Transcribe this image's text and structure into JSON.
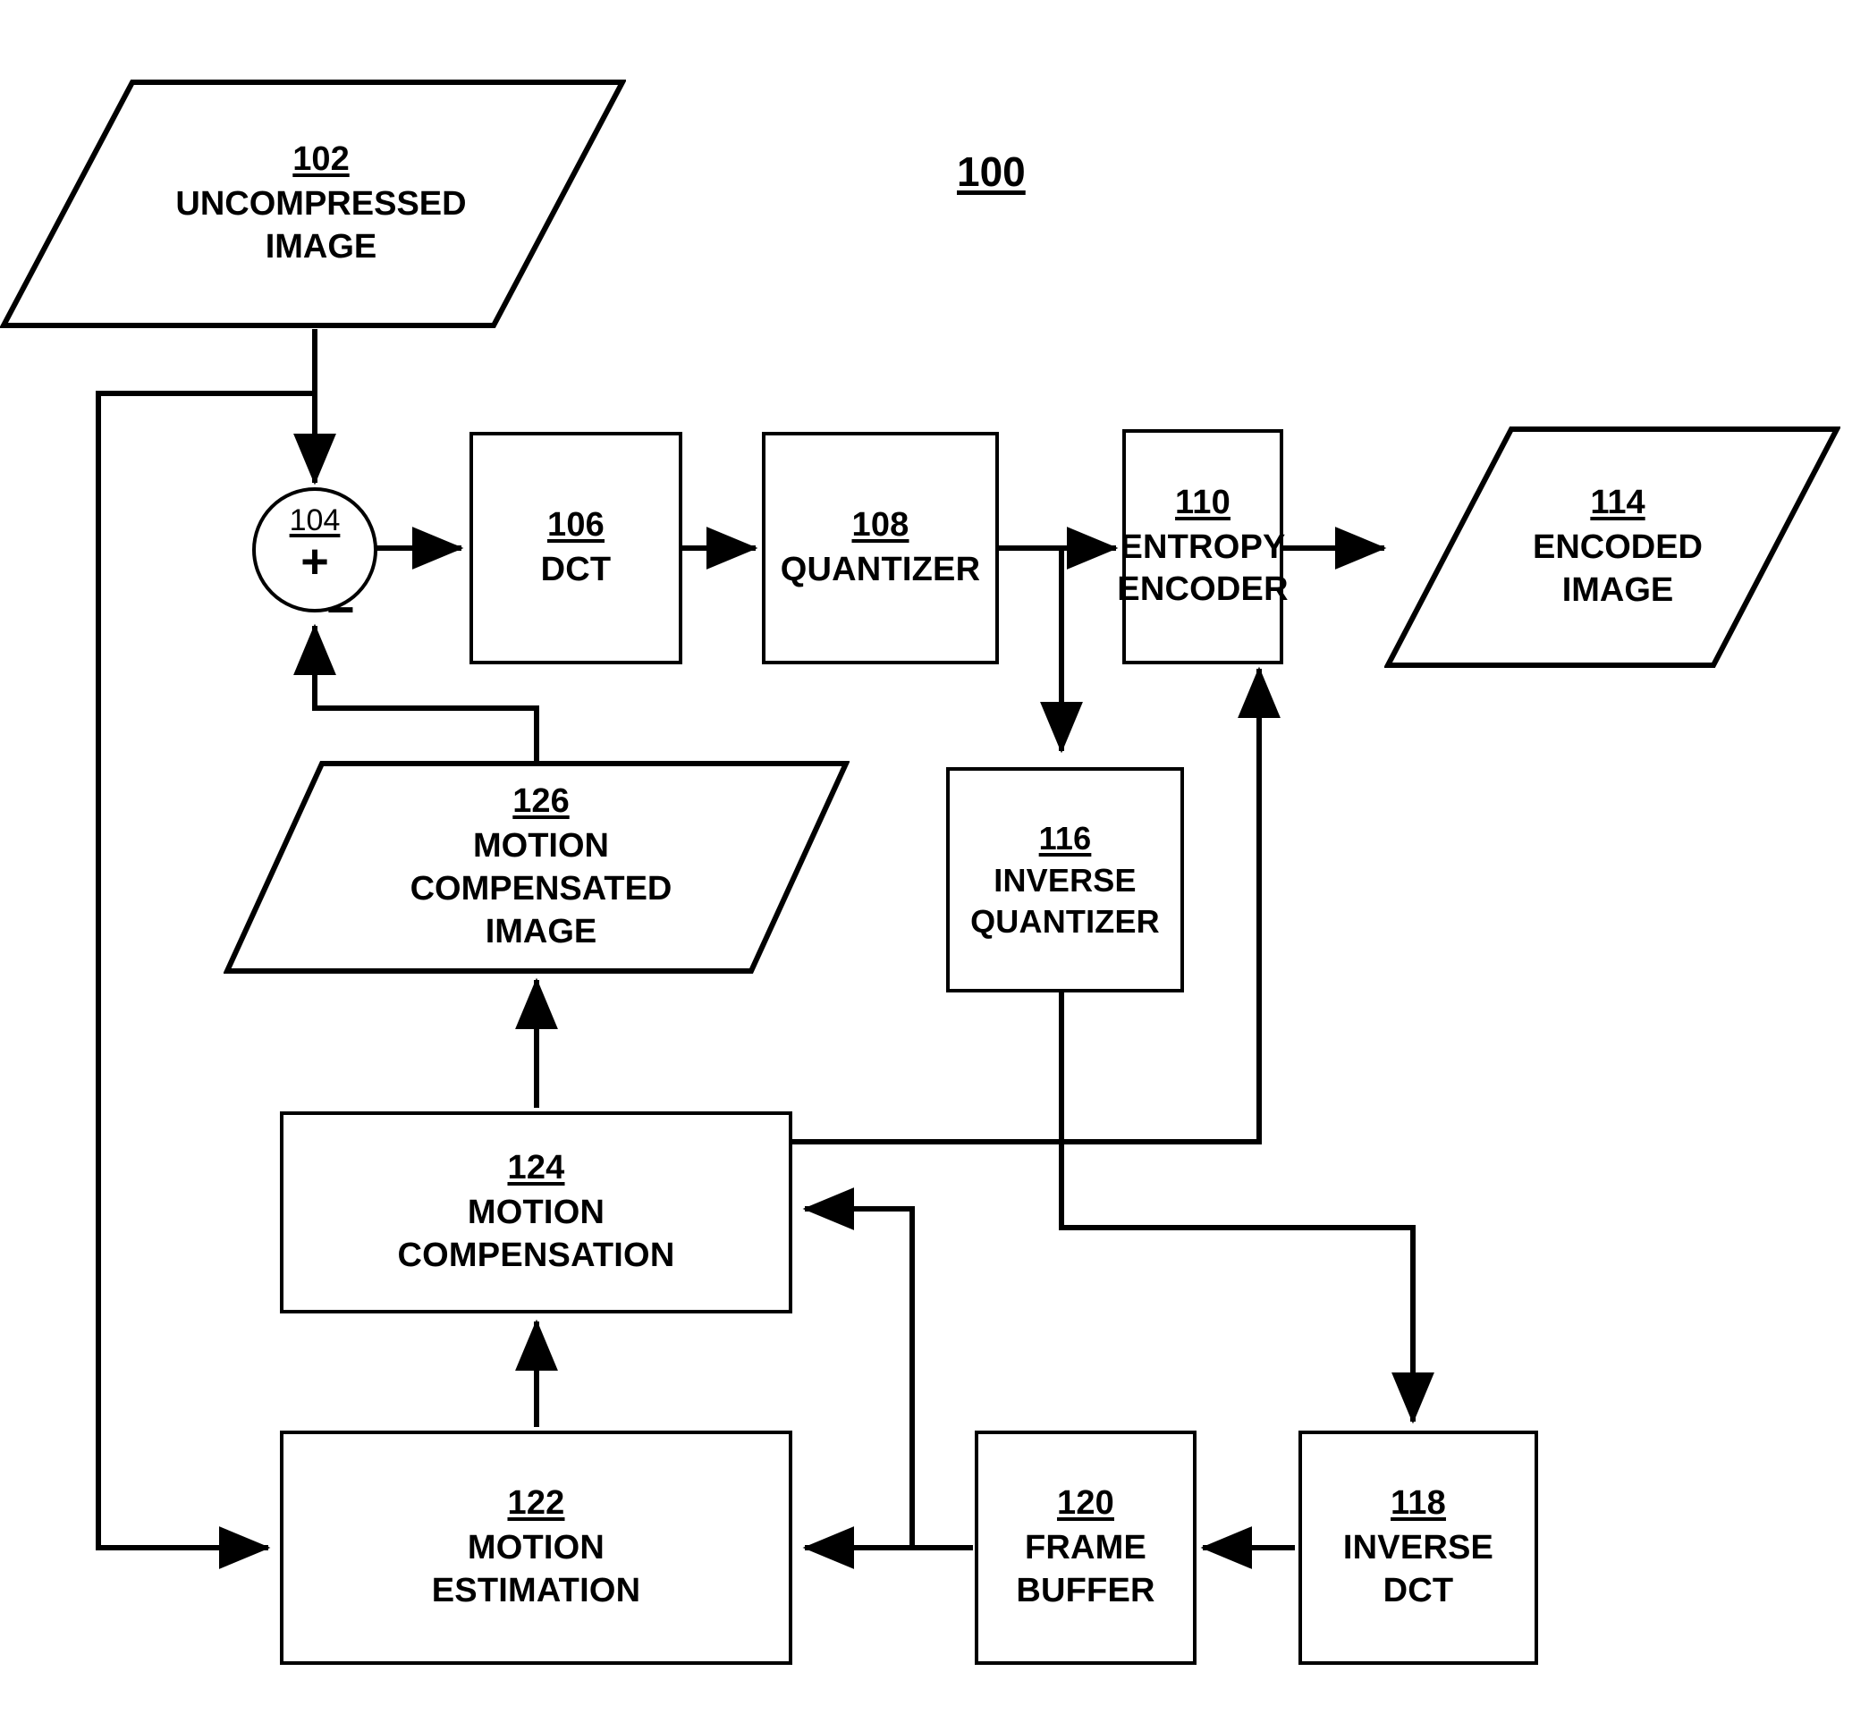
{
  "figure": {
    "title_ref": "100"
  },
  "nodes": {
    "uncompressed_image": {
      "ref": "102",
      "label": "UNCOMPRESSED\nIMAGE",
      "shape": "parallelogram"
    },
    "summing_junction": {
      "ref": "104",
      "plus": "+",
      "minus": "−",
      "shape": "circle"
    },
    "dct": {
      "ref": "106",
      "label": "DCT",
      "shape": "rectangle"
    },
    "quantizer": {
      "ref": "108",
      "label": "QUANTIZER",
      "shape": "rectangle"
    },
    "entropy_encoder": {
      "ref": "110",
      "label": "ENTROPY\nENCODER",
      "shape": "rectangle"
    },
    "encoded_image": {
      "ref": "114",
      "label": "ENCODED\nIMAGE",
      "shape": "parallelogram"
    },
    "inverse_quantizer": {
      "ref": "116",
      "label": "INVERSE\nQUANTIZER",
      "shape": "rectangle"
    },
    "inverse_dct": {
      "ref": "118",
      "label": "INVERSE\nDCT",
      "shape": "rectangle"
    },
    "frame_buffer": {
      "ref": "120",
      "label": "FRAME\nBUFFER",
      "shape": "rectangle"
    },
    "motion_estimation": {
      "ref": "122",
      "label": "MOTION\nESTIMATION",
      "shape": "rectangle"
    },
    "motion_compensation": {
      "ref": "124",
      "label": "MOTION\nCOMPENSATION",
      "shape": "rectangle"
    },
    "motion_compensated_image": {
      "ref": "126",
      "label": "MOTION\nCOMPENSATED\nIMAGE",
      "shape": "parallelogram"
    }
  },
  "style": {
    "line_color": "#000000",
    "background": "#ffffff",
    "text_color": "#000000"
  }
}
